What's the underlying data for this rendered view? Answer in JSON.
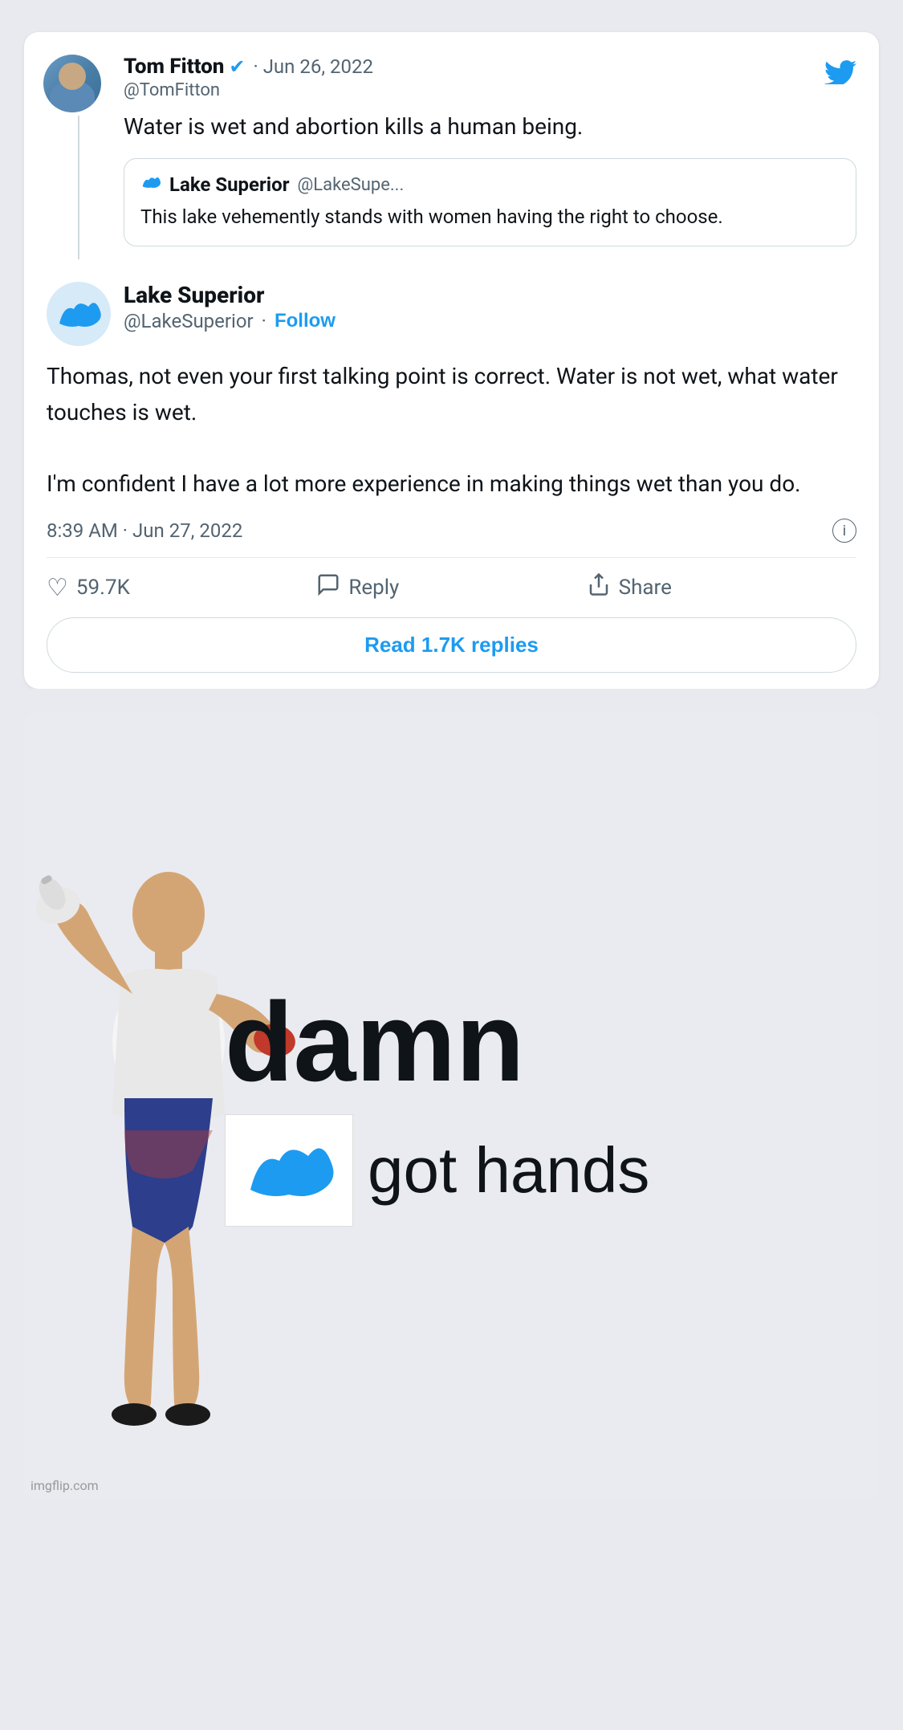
{
  "page": {
    "background": "#e8eaf0"
  },
  "tomFitton": {
    "name": "Tom Fitton",
    "handle": "@TomFitton",
    "date": "· Jun 26, 2022",
    "verified": "✓",
    "tweet": "Water is wet and abortion kills a human being.",
    "quotedUser": "Lake Superior",
    "quotedHandle": "@LakeSupe...",
    "quotedText": "This lake vehemently stands with women having the right to choose."
  },
  "lakeSuperior": {
    "name": "Lake Superior",
    "handle": "@LakeSuperior",
    "followLabel": "Follow",
    "tweetPart1": "Thomas, not even your first talking point is correct. Water is not wet, what water touches is wet.",
    "tweetPart2": "I'm confident I have a lot more experience in making things wet than you do.",
    "time": "8:39 AM · Jun 27, 2022",
    "likes": "59.7K",
    "replyLabel": "Reply",
    "shareLabel": "Share",
    "readReplies": "Read 1.7K replies"
  },
  "meme": {
    "damn": "damn",
    "gotHands": "got hands",
    "credit": "imgflip.com"
  }
}
